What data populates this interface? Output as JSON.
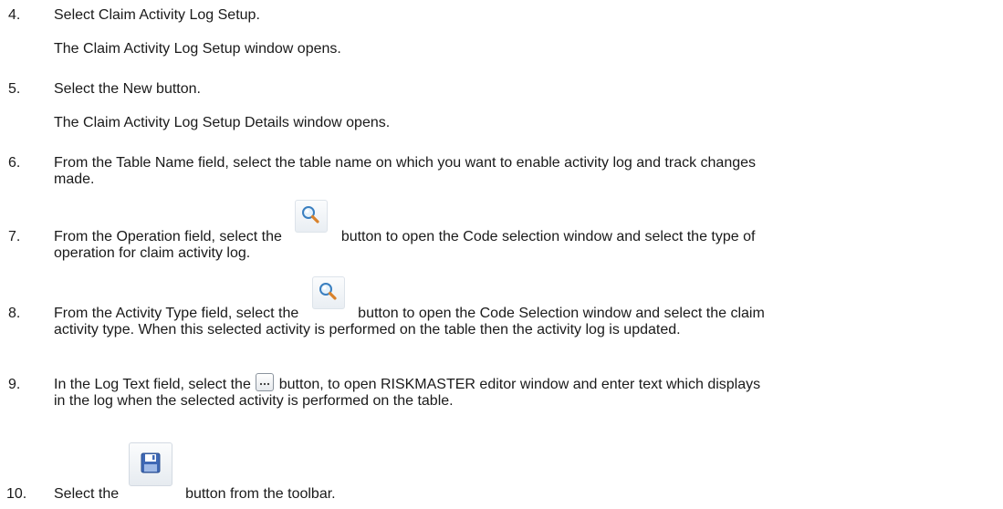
{
  "steps": [
    {
      "number": "4.",
      "text": "Select Claim Activity Log Setup.",
      "result": "The Claim Activity Log Setup window opens."
    },
    {
      "number": "5.",
      "text": "Select the New button.",
      "result": "The Claim Activity Log Setup Details window opens."
    },
    {
      "number": "6.",
      "line1": "From the Table Name field, select the table name on which you want to enable activity log and track changes",
      "line2": "made."
    },
    {
      "number": "7.",
      "before": "From the Operation field, select the",
      "after": "button to open the Code selection window and select the type of",
      "line2": "operation for claim activity log.",
      "icon": "search-icon"
    },
    {
      "number": "8.",
      "before": "From the Activity Type field, select the",
      "after": "button to open the Code Selection window and select the claim",
      "line2": "activity type. When this selected activity is performed on the table then the activity log is updated.",
      "icon": "search-icon"
    },
    {
      "number": "9.",
      "before": "In the Log Text field, select the",
      "after": "button, to open RISKMASTER editor window and enter text which displays",
      "line2": "in the log when the selected activity is performed on the table.",
      "icon": "ellipsis-icon"
    },
    {
      "number": "10.",
      "before": "Select the",
      "after": "button from the toolbar.",
      "icon": "save-icon"
    }
  ]
}
